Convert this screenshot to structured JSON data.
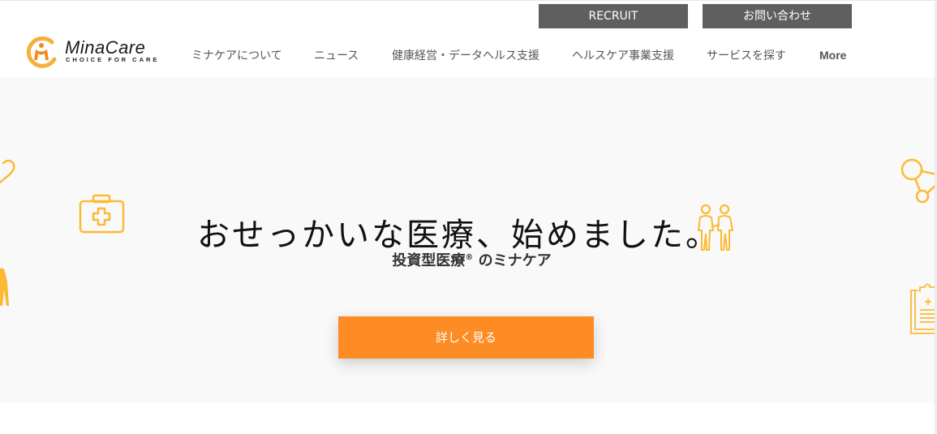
{
  "header": {
    "brand": {
      "name": "MinaCare",
      "tagline": "CHOICE FOR CARE"
    },
    "top_buttons": {
      "recruit": "RECRUIT",
      "contact": "お問い合わせ"
    },
    "nav": [
      {
        "label": "ミナケアについて"
      },
      {
        "label": "ニュース"
      },
      {
        "label": "健康経営・データヘルス支援"
      },
      {
        "label": "ヘルスケア事業支援"
      },
      {
        "label": "サービスを探す"
      },
      {
        "label": "More"
      }
    ]
  },
  "hero": {
    "headline": "おせっかいな医療、始めました。",
    "subtitle_main": "投資型医療",
    "subtitle_mark": "®",
    "subtitle_rest": " のミナケア",
    "cta_label": "詳しく見る",
    "icons": [
      "heart-icon",
      "first-aid-kit-icon",
      "walking-person-icon",
      "caregiver-patient-icon",
      "network-nodes-icon",
      "clipboard-icon"
    ]
  },
  "colors": {
    "accent_orange": "#fd8c24",
    "icon_yellow": "#fdb933",
    "button_gray": "#615e5e",
    "hero_bg": "#f9f9f9"
  }
}
